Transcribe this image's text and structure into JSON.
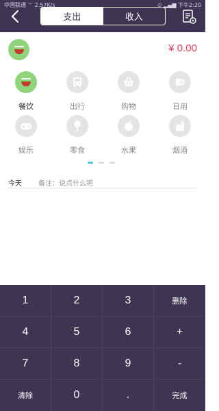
{
  "status_bar": {
    "carrier": "中国联通",
    "network_speed": "2.57K/s",
    "time": "下午2:20"
  },
  "header": {
    "tabs": [
      {
        "label": "支出",
        "active": true
      },
      {
        "label": "收入",
        "active": false
      }
    ],
    "back_icon": "chevron-left-icon",
    "note_icon": "note-edit-icon"
  },
  "entry": {
    "amount": "¥ 0.00",
    "selected_category_icon": "bowl-icon"
  },
  "categories": [
    {
      "label": "餐饮",
      "icon": "bowl-icon",
      "active": true
    },
    {
      "label": "出行",
      "icon": "bus-icon",
      "active": false
    },
    {
      "label": "购物",
      "icon": "basket-icon",
      "active": false
    },
    {
      "label": "日用",
      "icon": "tissue-roll-icon",
      "active": false
    },
    {
      "label": "娱乐",
      "icon": "gamepad-icon",
      "active": false
    },
    {
      "label": "零食",
      "icon": "lollipop-icon",
      "active": false
    },
    {
      "label": "水果",
      "icon": "apple-icon",
      "active": false
    },
    {
      "label": "烟酒",
      "icon": "bottle-icon",
      "active": false
    }
  ],
  "pager": {
    "pages": 3,
    "active": 0
  },
  "note_row": {
    "date_label": "今天",
    "remark_placeholder": "备注：说点什么吧"
  },
  "keypad": {
    "keys": [
      "1",
      "2",
      "3",
      "删除",
      "4",
      "5",
      "6",
      "+",
      "7",
      "8",
      "9",
      "-",
      "清除",
      "0",
      ".",
      "完成"
    ]
  },
  "colors": {
    "header_bg": "#3d3552",
    "accent_green": "#8fd37a",
    "amount_red": "#f0405c",
    "pager_active": "#4fc1ea"
  }
}
